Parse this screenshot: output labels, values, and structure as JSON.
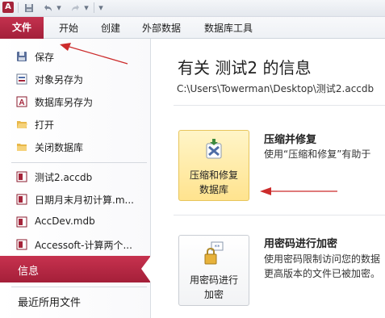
{
  "quick_access": {
    "app_icon": "access-app-icon",
    "buttons": [
      "save-icon",
      "undo-icon",
      "redo-icon",
      "customize-icon"
    ]
  },
  "tabs": [
    {
      "label": "文件"
    },
    {
      "label": "开始"
    },
    {
      "label": "创建"
    },
    {
      "label": "外部数据"
    },
    {
      "label": "数据库工具"
    }
  ],
  "nav": {
    "commands": [
      {
        "label": "保存",
        "icon": "save-icon"
      },
      {
        "label": "对象另存为",
        "icon": "save-object-icon"
      },
      {
        "label": "数据库另存为",
        "icon": "save-database-icon"
      },
      {
        "label": "打开",
        "icon": "open-folder-icon"
      },
      {
        "label": "关闭数据库",
        "icon": "close-database-icon"
      }
    ],
    "recent_files": [
      {
        "label": "测试2.accdb",
        "icon": "access-file-icon"
      },
      {
        "label": "日期月末月初计算.m...",
        "icon": "access-file-icon"
      },
      {
        "label": "AccDev.mdb",
        "icon": "access-file-icon"
      },
      {
        "label": "Accessoft-计算两个...",
        "icon": "access-file-icon"
      }
    ],
    "selected": "信息",
    "recent": "最近所用文件"
  },
  "info": {
    "title": "有关 测试2 的信息",
    "path": "C:\\Users\\Towerman\\Desktop\\测试2.accdb",
    "compact": {
      "button_line1": "压缩和修复",
      "button_line2": "数据库",
      "heading": "压缩并修复",
      "desc": "使用“压缩和修复”有助于"
    },
    "encrypt": {
      "button_line1": "用密码进行",
      "button_line2": "加密",
      "heading": "用密码进行加密",
      "desc_line1": "使用密码限制访问您的数据",
      "desc_line2": "更高版本的文件已被加密。"
    }
  },
  "colors": {
    "accent": "#b5283f",
    "annotation_arrow": "#cc2b2b",
    "active_button": "#ffe38e"
  }
}
